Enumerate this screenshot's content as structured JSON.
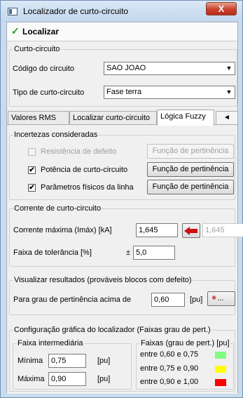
{
  "window": {
    "title": "Localizador de curto-circuito",
    "close_glyph": "X",
    "icon": "app-window-icon"
  },
  "toolbar": {
    "check_glyph": "✓",
    "action_label": "Localizar"
  },
  "curto": {
    "title": "Curto-circuito",
    "circuit_label": "Código do circuito",
    "circuit_value": "SAO JOAO",
    "type_label": "Tipo de curto-circuito",
    "type_value": "Fase terra",
    "arrow": "▼"
  },
  "tabs": [
    {
      "label": "Valores RMS",
      "active": false
    },
    {
      "label": "Localizar curto-circuito",
      "active": false
    },
    {
      "label": "Lógica Fuzzy",
      "active": true
    }
  ],
  "tab_scroll_glyph": "◄",
  "incertezas": {
    "title": "Incertezas consideradas",
    "items": [
      {
        "label": "Resistência de defeito",
        "checked": false,
        "enabled": false,
        "button": "Função de pertinência"
      },
      {
        "label": "Potência de curto-circuito",
        "checked": true,
        "enabled": true,
        "button": "Função de pertinência"
      },
      {
        "label": "Parâmetros físicos da linha",
        "checked": true,
        "enabled": true,
        "button": "Função de pertinência"
      }
    ],
    "check_glyph": "✔"
  },
  "corrente": {
    "title": "Corrente de curto-circuito",
    "max_label": "Corrente máxima (Imáx) [kA]",
    "max_value": "1,645",
    "copy_value": "1,645",
    "tol_label": "Faixa de tolerância [%]",
    "tol_prefix": "±",
    "tol_value": "5,0"
  },
  "visualizar": {
    "title": "Visualizar resultados (prováveis blocos com defeito)",
    "label": "Para grau de pertinência acima de",
    "value": "0,60",
    "unit": "[pu]",
    "button_text": "..."
  },
  "config": {
    "title": "Configuração gráfica do localizador (Faixas grau de pert.)",
    "inter": {
      "title": "Faixa intermediária",
      "min_label": "Mínima",
      "min_value": "0,75",
      "max_label": "Máxima",
      "max_value": "0,90",
      "unit": "[pu]"
    },
    "faixas": {
      "title": "Faixas (grau de pert.) [pu]",
      "items": [
        {
          "label": "entre 0,60 e 0,75",
          "color": "#80ff80"
        },
        {
          "label": "entre 0,75 e 0,90",
          "color": "#ffff00"
        },
        {
          "label": "entre 0,90 e 1,00",
          "color": "#ff0000"
        }
      ]
    }
  }
}
